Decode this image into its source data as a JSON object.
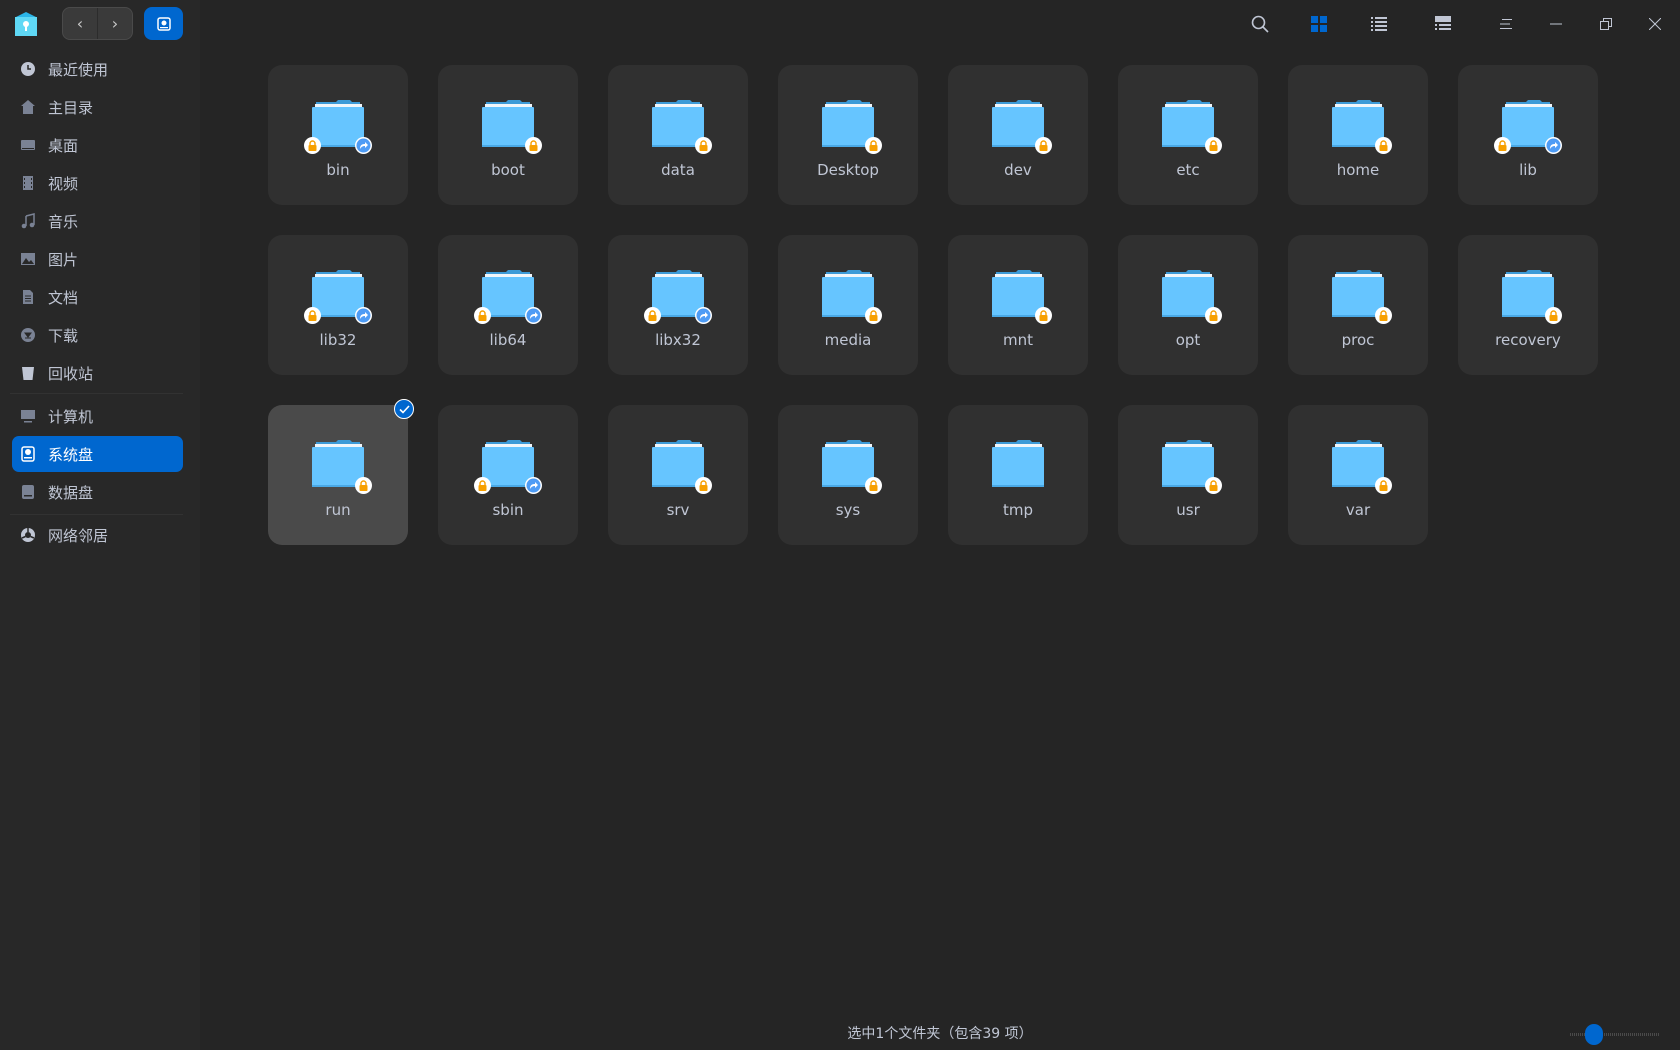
{
  "sidebar": {
    "items": [
      {
        "label": "最近使用",
        "icon": "clock-icon"
      },
      {
        "label": "主目录",
        "icon": "home-icon"
      },
      {
        "label": "桌面",
        "icon": "desktop-icon"
      },
      {
        "label": "视频",
        "icon": "video-icon"
      },
      {
        "label": "音乐",
        "icon": "music-icon"
      },
      {
        "label": "图片",
        "icon": "picture-icon"
      },
      {
        "label": "文档",
        "icon": "document-icon"
      },
      {
        "label": "下载",
        "icon": "download-icon"
      },
      {
        "label": "回收站",
        "icon": "trash-icon"
      },
      {
        "label": "计算机",
        "icon": "computer-icon"
      },
      {
        "label": "系统盘",
        "icon": "system-disk-icon",
        "active": true
      },
      {
        "label": "数据盘",
        "icon": "data-disk-icon"
      },
      {
        "label": "网络邻居",
        "icon": "network-icon"
      }
    ]
  },
  "files": [
    {
      "name": "bin",
      "lock": true,
      "link": true
    },
    {
      "name": "boot",
      "lock": true
    },
    {
      "name": "data",
      "lock": true
    },
    {
      "name": "Desktop",
      "lock": true
    },
    {
      "name": "dev",
      "lock": true
    },
    {
      "name": "etc",
      "lock": true
    },
    {
      "name": "home",
      "lock": true
    },
    {
      "name": "lib",
      "lock": true,
      "link": true
    },
    {
      "name": "lib32",
      "lock": true,
      "link": true
    },
    {
      "name": "lib64",
      "lock": true,
      "link": true
    },
    {
      "name": "libx32",
      "lock": true,
      "link": true
    },
    {
      "name": "media",
      "lock": true
    },
    {
      "name": "mnt",
      "lock": true
    },
    {
      "name": "opt",
      "lock": true
    },
    {
      "name": "proc",
      "lock": true
    },
    {
      "name": "recovery",
      "lock": true
    },
    {
      "name": "run",
      "lock": true,
      "selected": true
    },
    {
      "name": "sbin",
      "lock": true,
      "link": true
    },
    {
      "name": "srv",
      "lock": true
    },
    {
      "name": "sys",
      "lock": true
    },
    {
      "name": "tmp"
    },
    {
      "name": "usr",
      "lock": true
    },
    {
      "name": "var",
      "lock": true
    }
  ],
  "status": {
    "text": "选中1个文件夹（包含39 项）",
    "icon_size_level": 0.15
  },
  "colors": {
    "accent": "#0067cf",
    "folder": "#66c5ff",
    "lock": "#f7a000"
  }
}
